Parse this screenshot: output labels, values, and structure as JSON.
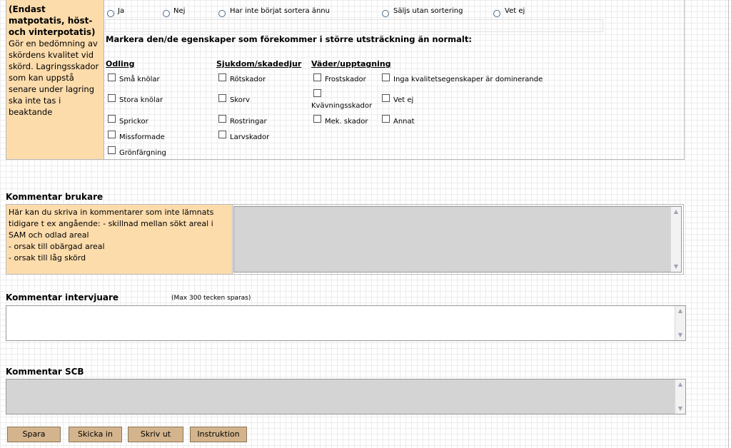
{
  "quality": {
    "left_title": "(Endast matpotatis, höst- och vinterpotatis)",
    "left_desc": "Gör en bedömning av skördens kvalitet vid skörd. Lagringsskador som kan uppstå senare under lagring ska inte tas i beaktande",
    "radio_options": [
      "Ja",
      "Nej",
      "Har inte börjat sortera ännu",
      "Säljs utan sortering",
      "Vet ej"
    ],
    "instruction": "Markera den/de egenskaper som förekommer i större utsträckning än normalt:",
    "columns": {
      "odling": {
        "title": "Odling",
        "items": [
          "Små knölar",
          "Stora knölar",
          "Sprickor",
          "Missformade",
          "Grönfärgning"
        ]
      },
      "sjukdom": {
        "title": "Sjukdom/skadedjur",
        "items": [
          "Rötskador",
          "Skorv",
          "Rostringar",
          "Larvskador"
        ]
      },
      "vader": {
        "title": "Väder/upptagning",
        "items": [
          "Frostskador",
          "Kvävningsskador",
          "Mek. skador"
        ]
      },
      "other": {
        "items": [
          "Inga kvalitetsegenskaper är dominerande",
          "Vet ej",
          "Annat"
        ]
      }
    }
  },
  "kommentar_brukare": {
    "title": "Kommentar brukare",
    "help_lines": [
      "Här kan du skriva in kommentarer som inte lämnats tidigare t ex angående: - skillnad mellan sökt areal i SAM och  odlad areal",
      "- orsak till obärgad areal",
      "- orsak till låg skörd"
    ],
    "value": ""
  },
  "kommentar_intervjuare": {
    "title": "Kommentar intervjuare",
    "note": "(Max 300 tecken sparas)",
    "value": ""
  },
  "kommentar_scb": {
    "title": "Kommentar SCB",
    "value": ""
  },
  "buttons": {
    "spara": "Spara",
    "skicka_in": "Skicka in",
    "skriv_ut": "Skriv ut",
    "instruktion": "Instruktion"
  },
  "scroll_icons": {
    "up": "scroll-up-arrow-icon",
    "down": "scroll-down-arrow-icon"
  }
}
